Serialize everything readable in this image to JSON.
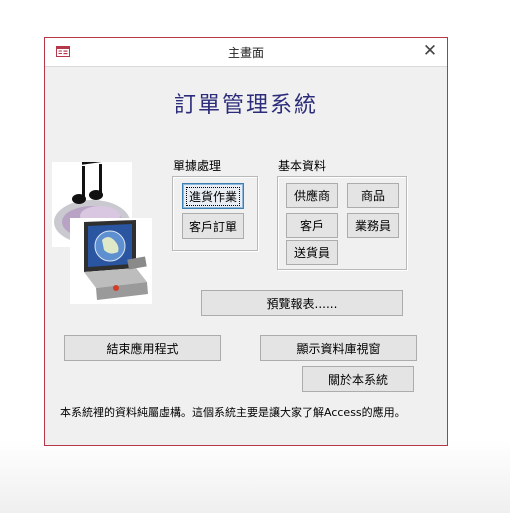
{
  "window": {
    "title": "主畫面",
    "close_symbol": "✕",
    "app_icon": "form-icon",
    "border_color": "#b5374a"
  },
  "heading": {
    "text": "訂單管理系統",
    "color": "#2c2c7a"
  },
  "clipart": {
    "icon": "music-note-globe-computer-clipart"
  },
  "groups": {
    "transactions": {
      "label": "單據處理",
      "buttons": [
        {
          "label": "進貨作業",
          "focused": true
        },
        {
          "label": "客戶訂單"
        }
      ]
    },
    "basic_data": {
      "label": "基本資料",
      "buttons": [
        {
          "label": "供應商"
        },
        {
          "label": "商品"
        },
        {
          "label": "客戶"
        },
        {
          "label": "業務員"
        },
        {
          "label": "送貨員"
        }
      ]
    }
  },
  "actions": {
    "preview_reports": "預覽報表......",
    "exit_app": "結束應用程式",
    "show_db_window": "顯示資料庫視窗",
    "about": "關於本系統"
  },
  "footer_note": "本系統裡的資料純屬虛構。這個系統主要是讓大家了解Access的應用。"
}
